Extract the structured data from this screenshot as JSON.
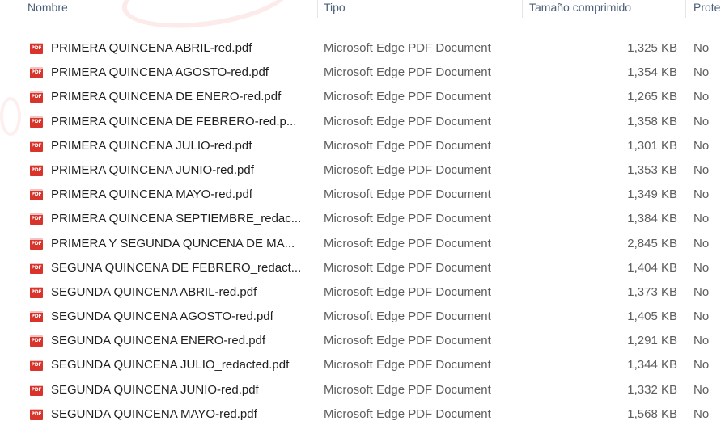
{
  "columns": {
    "name": "Nombre",
    "type": "Tipo",
    "size": "Tamaño comprimido",
    "protected": "Prote"
  },
  "file_icon": "pdf-file-icon",
  "files": [
    {
      "name": "PRIMERA QUINCENA ABRIL-red.pdf",
      "type": "Microsoft Edge PDF Document",
      "size": "1,325 KB",
      "protected": "No"
    },
    {
      "name": "PRIMERA QUINCENA AGOSTO-red.pdf",
      "type": "Microsoft Edge PDF Document",
      "size": "1,354 KB",
      "protected": "No"
    },
    {
      "name": "PRIMERA QUINCENA DE ENERO-red.pdf",
      "type": "Microsoft Edge PDF Document",
      "size": "1,265 KB",
      "protected": "No"
    },
    {
      "name": "PRIMERA QUINCENA DE FEBRERO-red.p...",
      "type": "Microsoft Edge PDF Document",
      "size": "1,358 KB",
      "protected": "No"
    },
    {
      "name": "PRIMERA QUINCENA JULIO-red.pdf",
      "type": "Microsoft Edge PDF Document",
      "size": "1,301 KB",
      "protected": "No"
    },
    {
      "name": "PRIMERA QUINCENA JUNIO-red.pdf",
      "type": "Microsoft Edge PDF Document",
      "size": "1,353 KB",
      "protected": "No"
    },
    {
      "name": "PRIMERA QUINCENA MAYO-red.pdf",
      "type": "Microsoft Edge PDF Document",
      "size": "1,349 KB",
      "protected": "No"
    },
    {
      "name": "PRIMERA QUINCENA SEPTIEMBRE_redac...",
      "type": "Microsoft Edge PDF Document",
      "size": "1,384 KB",
      "protected": "No"
    },
    {
      "name": "PRIMERA Y SEGUNDA QUNCENA DE MA...",
      "type": "Microsoft Edge PDF Document",
      "size": "2,845 KB",
      "protected": "No"
    },
    {
      "name": "SEGUNA QUINCENA DE FEBRERO_redact...",
      "type": "Microsoft Edge PDF Document",
      "size": "1,404 KB",
      "protected": "No"
    },
    {
      "name": "SEGUNDA QUINCENA ABRIL-red.pdf",
      "type": "Microsoft Edge PDF Document",
      "size": "1,373 KB",
      "protected": "No"
    },
    {
      "name": "SEGUNDA QUINCENA AGOSTO-red.pdf",
      "type": "Microsoft Edge PDF Document",
      "size": "1,405 KB",
      "protected": "No"
    },
    {
      "name": "SEGUNDA QUINCENA ENERO-red.pdf",
      "type": "Microsoft Edge PDF Document",
      "size": "1,291 KB",
      "protected": "No"
    },
    {
      "name": "SEGUNDA QUINCENA JULIO_redacted.pdf",
      "type": "Microsoft Edge PDF Document",
      "size": "1,344 KB",
      "protected": "No"
    },
    {
      "name": "SEGUNDA QUINCENA JUNIO-red.pdf",
      "type": "Microsoft Edge PDF Document",
      "size": "1,332 KB",
      "protected": "No"
    },
    {
      "name": "SEGUNDA QUINCENA MAYO-red.pdf",
      "type": "Microsoft Edge PDF Document",
      "size": "1,568 KB",
      "protected": "No"
    }
  ]
}
